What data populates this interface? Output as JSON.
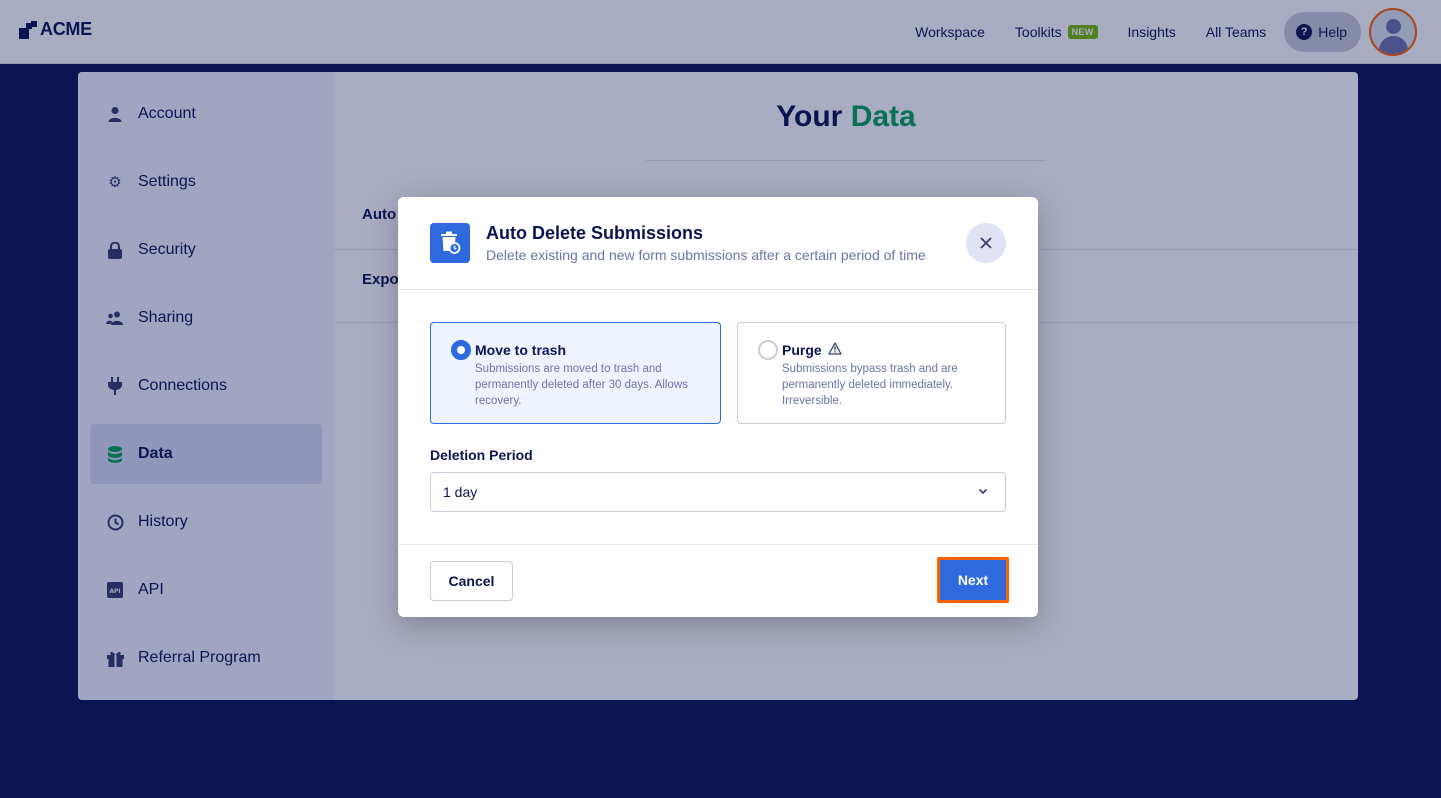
{
  "brand": {
    "name": "ACME"
  },
  "nav": {
    "links": [
      "Workspace",
      "Toolkits",
      "Insights",
      "All Teams"
    ],
    "toolkits_badge": "NEW",
    "help_label": "Help"
  },
  "sidebar": {
    "items": [
      {
        "label": "Account",
        "icon": "user-icon"
      },
      {
        "label": "Settings",
        "icon": "gear-icon"
      },
      {
        "label": "Security",
        "icon": "lock-icon"
      },
      {
        "label": "Sharing",
        "icon": "users-icon"
      },
      {
        "label": "Connections",
        "icon": "plug-icon"
      },
      {
        "label": "Data",
        "icon": "database-icon",
        "active": true
      },
      {
        "label": "History",
        "icon": "history-icon"
      },
      {
        "label": "API",
        "icon": "api-icon"
      },
      {
        "label": "Referral Program",
        "icon": "gift-icon"
      }
    ]
  },
  "content": {
    "title_prefix": "Your",
    "title_accent": "Data",
    "row_1_label": "Auto",
    "row_2_label": "Expo"
  },
  "modal": {
    "title": "Auto Delete Submissions",
    "subtitle": "Delete existing and new form submissions after a certain period of time",
    "options": [
      {
        "title": "Move to trash",
        "description": "Submissions are moved to trash and permanently deleted after 30 days. Allows recovery.",
        "selected": true
      },
      {
        "title": "Purge",
        "description": "Submissions bypass trash and are permanently deleted immediately. Irreversible.",
        "selected": false
      }
    ],
    "field_label": "Deletion Period",
    "select_value": "1 day",
    "cancel_label": "Cancel",
    "next_label": "Next"
  },
  "colors": {
    "navy": "#0a1551",
    "accent_green": "#09a155",
    "primary_blue": "#2e69de",
    "highlight_orange": "#ff6100",
    "badge_green": "#78bb07"
  }
}
